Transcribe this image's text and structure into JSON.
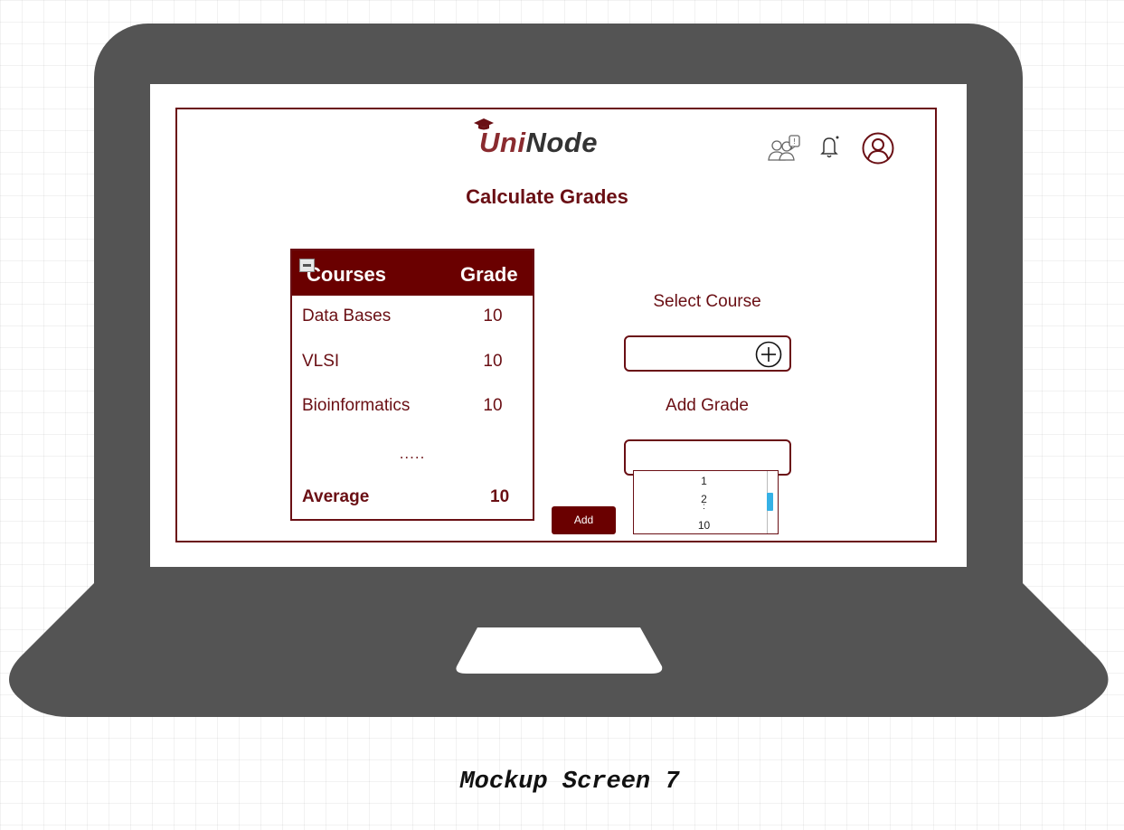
{
  "app": {
    "logo_part1": "Uni",
    "logo_part2": "Node",
    "title": "Calculate Grades"
  },
  "header_icons": [
    "group-chat-icon",
    "bell-icon",
    "user-profile-icon"
  ],
  "table": {
    "headers": [
      "Courses",
      "Grade"
    ],
    "rows": [
      {
        "course": "Data Bases",
        "grade": "10"
      },
      {
        "course": "VLSI",
        "grade": "10"
      },
      {
        "course": "Bioinformatics",
        "grade": "10"
      }
    ],
    "ellipsis": ".....",
    "average_label": "Average",
    "average_value": "10"
  },
  "form": {
    "select_course_label": "Select Course",
    "select_course_value": "",
    "add_grade_label": "Add Grade",
    "add_grade_value": "",
    "grade_options": [
      "1",
      "2",
      ":",
      "10"
    ],
    "add_button": "Add"
  },
  "caption": "Mockup Screen 7",
  "colors": {
    "brand": "#6a0f14",
    "laptop": "#545454",
    "scroll_thumb": "#35b1e6"
  }
}
